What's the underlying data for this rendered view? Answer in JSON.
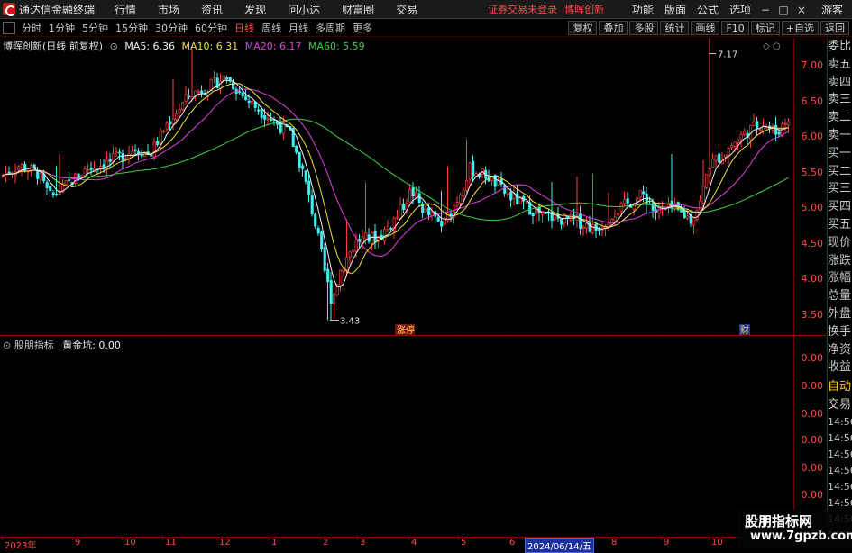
{
  "menubar": {
    "app_title": "通达信金融终端",
    "items": [
      "行情",
      "市场",
      "资讯",
      "发现",
      "问小达",
      "财富圈",
      "交易"
    ],
    "warning": "证券交易未登录",
    "stock_link": "博晖创新",
    "right_items": [
      "功能",
      "版面",
      "公式",
      "选项"
    ],
    "user": "游客"
  },
  "periodbar": {
    "periods": [
      "分时",
      "1分钟",
      "5分钟",
      "15分钟",
      "30分钟",
      "60分钟",
      "日线",
      "周线",
      "月线",
      "多周期",
      "更多"
    ],
    "active": "日线",
    "tools": [
      "复权",
      "叠加",
      "多股",
      "统计",
      "画线",
      "F10",
      "标记",
      "+自选",
      "返回"
    ]
  },
  "legend": {
    "title": "博晖创新(日线 前复权)",
    "ma5": "MA5: 6.36",
    "ma10": "MA10: 6.31",
    "ma20": "MA20: 6.17",
    "ma60": "MA60: 5.59"
  },
  "colors": {
    "up": "#ff3c3c",
    "down": "#40f0f0",
    "ma5": "#f0f0f0",
    "ma10": "#f0e040",
    "ma20": "#e040e0",
    "ma60": "#40d040",
    "axis_red": "#ff4a4a"
  },
  "price_axis": [
    "7.00",
    "6.50",
    "6.00",
    "5.50",
    "5.00",
    "4.50",
    "4.00",
    "3.50"
  ],
  "annotations": {
    "high": "7.17",
    "low": "3.43",
    "badge_zhangting": "涨停",
    "badge_cai": "财"
  },
  "indicator": {
    "name": "股朋指标",
    "line": "黄金坑: 0.00",
    "axis": [
      "0.00",
      "0.00",
      "0.00",
      "0.00",
      "0.00",
      "0.00"
    ]
  },
  "sidepanel": {
    "items": [
      "委比",
      "卖五",
      "卖四",
      "卖三",
      "卖二",
      "卖一",
      "买一",
      "买二",
      "买三",
      "买四",
      "买五",
      "现价",
      "涨跌",
      "涨幅",
      "总量",
      "外盘",
      "换手",
      "净资",
      "收益"
    ],
    "auto": "自动",
    "trade": "交易",
    "times": [
      "14:56",
      "14:56",
      "14:56",
      "14:56",
      "14:56",
      "14:56",
      "14:56",
      "14:56",
      "14:56",
      "14:56"
    ]
  },
  "dateaxis": {
    "labels": [
      "2023年",
      "9",
      "10",
      "11",
      "12",
      "1",
      "2",
      "3",
      "4",
      "5",
      "6",
      "8",
      "9",
      "10"
    ],
    "cursor_date": "2024/06/14/五"
  },
  "watermark": {
    "title": "股朋指标网",
    "url": "www.7gpzb.com"
  },
  "chart_data": {
    "type": "candlestick",
    "ylim": [
      3.3,
      7.3
    ],
    "yticks": [
      3.5,
      4.0,
      4.5,
      5.0,
      5.5,
      6.0,
      6.5,
      7.0
    ],
    "high": 7.17,
    "low": 3.43,
    "close_last": 6.36,
    "ma": {
      "MA5": 6.36,
      "MA10": 6.31,
      "MA20": 6.17,
      "MA60": 5.59
    }
  }
}
